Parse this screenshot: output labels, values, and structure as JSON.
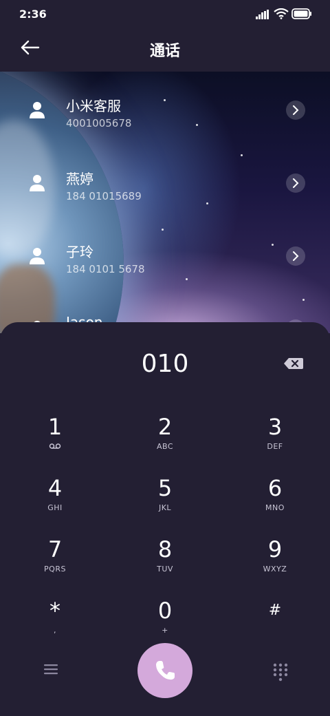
{
  "status": {
    "time": "2:36"
  },
  "header": {
    "title": "通话"
  },
  "contacts": [
    {
      "name": "小米客服",
      "number": "4001005678"
    },
    {
      "name": "燕婷",
      "number": "184 01015689"
    },
    {
      "name": "子玲",
      "number": "184 0101 5678"
    },
    {
      "name": "Jason",
      "number": ""
    }
  ],
  "dialer": {
    "entry": "010",
    "keys": [
      {
        "digit": "1",
        "letters": ""
      },
      {
        "digit": "2",
        "letters": "ABC"
      },
      {
        "digit": "3",
        "letters": "DEF"
      },
      {
        "digit": "4",
        "letters": "GHI"
      },
      {
        "digit": "5",
        "letters": "JKL"
      },
      {
        "digit": "6",
        "letters": "MNO"
      },
      {
        "digit": "7",
        "letters": "PQRS"
      },
      {
        "digit": "8",
        "letters": "TUV"
      },
      {
        "digit": "9",
        "letters": "WXYZ"
      },
      {
        "digit": "*",
        "letters": ","
      },
      {
        "digit": "0",
        "letters": "+"
      },
      {
        "digit": "#",
        "letters": ""
      }
    ]
  },
  "icons": {
    "back": "arrow-left-icon",
    "delete": "backspace-icon",
    "menu": "menu-icon",
    "call": "phone-icon",
    "keypad": "dialpad-icon",
    "voicemail": "voicemail-icon"
  },
  "colors": {
    "background": "#231f33",
    "call_button": "#d4a9db"
  }
}
